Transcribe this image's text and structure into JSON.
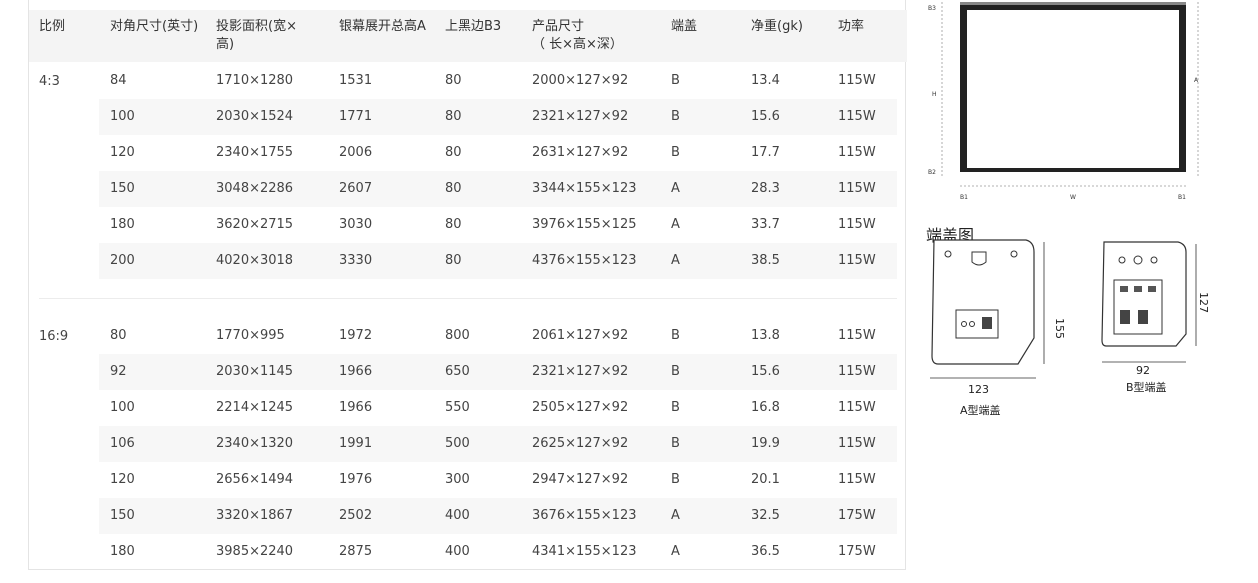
{
  "table": {
    "headers": [
      "比例",
      "对角尺寸(英寸)",
      "投影面积(宽×\n高)",
      "银幕展开总高A",
      "上黑边B3",
      "产品尺寸\n（ 长×高×深）",
      "端盖",
      "净重(gk)",
      "功率"
    ],
    "groups": [
      {
        "ratio": "4:3",
        "rows": [
          [
            "84",
            "1710×1280",
            "1531",
            "80",
            "2000×127×92",
            "B",
            "13.4",
            "115W"
          ],
          [
            "100",
            "2030×1524",
            "1771",
            "80",
            "2321×127×92",
            "B",
            "15.6",
            "115W"
          ],
          [
            "120",
            "2340×1755",
            "2006",
            "80",
            "2631×127×92",
            "B",
            "17.7",
            "115W"
          ],
          [
            "150",
            "3048×2286",
            "2607",
            "80",
            "3344×155×123",
            "A",
            "28.3",
            "115W"
          ],
          [
            "180",
            "3620×2715",
            "3030",
            "80",
            "3976×155×125",
            "A",
            "33.7",
            "115W"
          ],
          [
            "200",
            "4020×3018",
            "3330",
            "80",
            "4376×155×123",
            "A",
            "38.5",
            "115W"
          ]
        ]
      },
      {
        "ratio": "16:9",
        "rows": [
          [
            "80",
            "1770×995",
            "1972",
            "800",
            "2061×127×92",
            "B",
            "13.8",
            "115W"
          ],
          [
            "92",
            "2030×1145",
            "1966",
            "650",
            "2321×127×92",
            "B",
            "15.6",
            "115W"
          ],
          [
            "100",
            "2214×1245",
            "1966",
            "550",
            "2505×127×92",
            "B",
            "16.8",
            "115W"
          ],
          [
            "106",
            "2340×1320",
            "1991",
            "500",
            "2625×127×92",
            "B",
            "19.9",
            "115W"
          ],
          [
            "120",
            "2656×1494",
            "1976",
            "300",
            "2947×127×92",
            "B",
            "20.1",
            "115W"
          ],
          [
            "150",
            "3320×1867",
            "2502",
            "400",
            "3676×155×123",
            "A",
            "32.5",
            "175W"
          ],
          [
            "180",
            "3985×2240",
            "2875",
            "400",
            "4341×155×123",
            "A",
            "36.5",
            "175W"
          ]
        ]
      }
    ]
  },
  "screen_diagram": {
    "labels": [
      "B3",
      "H",
      "A",
      "B2",
      "B1",
      "W",
      "B1"
    ]
  },
  "endcap": {
    "title": "端盖图",
    "a_label": "A型端盖",
    "a_height": "155",
    "a_width": "123",
    "b_label": "B型端盖",
    "b_height": "127",
    "b_width": "92"
  }
}
